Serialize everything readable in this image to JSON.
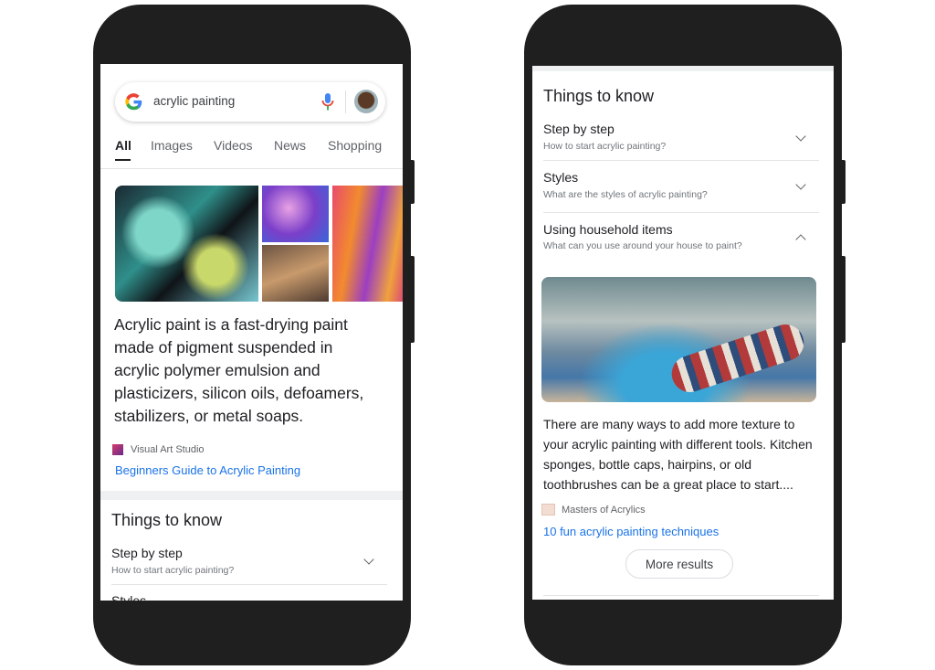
{
  "left_phone": {
    "search": {
      "query": "acrylic painting",
      "logo": "google-g-icon",
      "mic_icon": "mic-icon",
      "avatar": "user-avatar"
    },
    "tabs": [
      {
        "label": "All",
        "active": true
      },
      {
        "label": "Images"
      },
      {
        "label": "Videos"
      },
      {
        "label": "News"
      },
      {
        "label": "Shopping"
      }
    ],
    "description": "Acrylic paint is a fast-drying paint made of pigment suspended in acrylic polymer emulsion and plasticizers, silicon oils, defoamers, stabilizers, or metal soaps.",
    "source": "Visual Art Studio",
    "link": "Beginners Guide to Acrylic Painting",
    "things_to_know": {
      "title": "Things to know",
      "items": [
        {
          "title": "Step by step",
          "subtitle": "How to start acrylic painting?"
        },
        {
          "title": "Styles"
        }
      ]
    }
  },
  "right_phone": {
    "things_to_know": {
      "title": "Things to know",
      "items": [
        {
          "title": "Step by step",
          "subtitle": "How to start acrylic painting?",
          "expanded": false
        },
        {
          "title": "Styles",
          "subtitle": "What are the styles of acrylic painting?",
          "expanded": false
        },
        {
          "title": "Using household items",
          "subtitle": "What can you use around your house to paint?",
          "expanded": true
        }
      ]
    },
    "answer": "There are many ways to add more texture to your acrylic painting with different tools. Kitchen sponges, bottle caps, hairpins, or old toothbrushes can be a great place to start....",
    "source": "Masters of Acrylics",
    "link": "10 fun acrylic painting techniques",
    "more_button": "More results"
  },
  "colors": {
    "link": "#1a73e8",
    "phone_body": "#1f1f1f"
  }
}
